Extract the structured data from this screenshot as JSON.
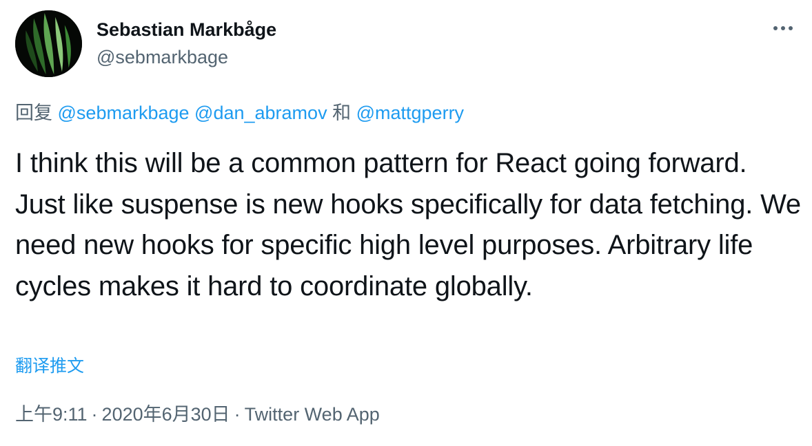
{
  "author": {
    "display_name": "Sebastian Markbåge",
    "handle": "@sebmarkbage",
    "avatar_icon": "leaf-icon"
  },
  "more_icon": "more-horizontal-icon",
  "reply": {
    "prefix": "回复",
    "mentions": [
      "@sebmarkbage",
      "@dan_abramov"
    ],
    "conjunction": "和",
    "last_mention": "@mattgperry"
  },
  "tweet_text": "I think this will be a common pattern for React going forward. Just like suspense is new hooks specifically for data fetching. We need new hooks for specific high level purposes. Arbitrary life cycles makes it hard to coordinate globally.",
  "translate_label": "翻译推文",
  "meta": {
    "time": "上午9:11",
    "separator": "·",
    "date": "2020年6月30日",
    "source": "Twitter Web App"
  },
  "colors": {
    "text": "#0f1419",
    "secondary": "#536471",
    "link": "#1d9bf0"
  }
}
